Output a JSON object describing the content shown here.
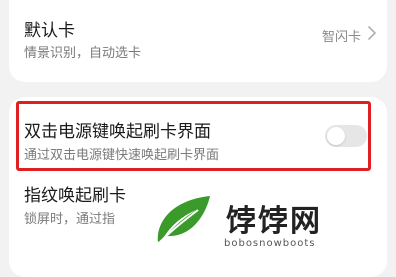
{
  "default_card": {
    "title": "默认卡",
    "subtitle": "情景识别，自动选卡",
    "value": "智闪卡"
  },
  "power_key_setting": {
    "title": "双击电源键唤起刷卡界面",
    "subtitle": "通过双击电源键快速唤起刷卡界面",
    "enabled": false
  },
  "fingerprint_setting": {
    "title": "指纹唤起刷卡",
    "subtitle": "锁屏时，通过指"
  },
  "watermark": {
    "name": "饽饽网",
    "domain": "bobosnowboots"
  },
  "colors": {
    "highlight": "#e02020",
    "logo_green": "#3a9a2a"
  }
}
